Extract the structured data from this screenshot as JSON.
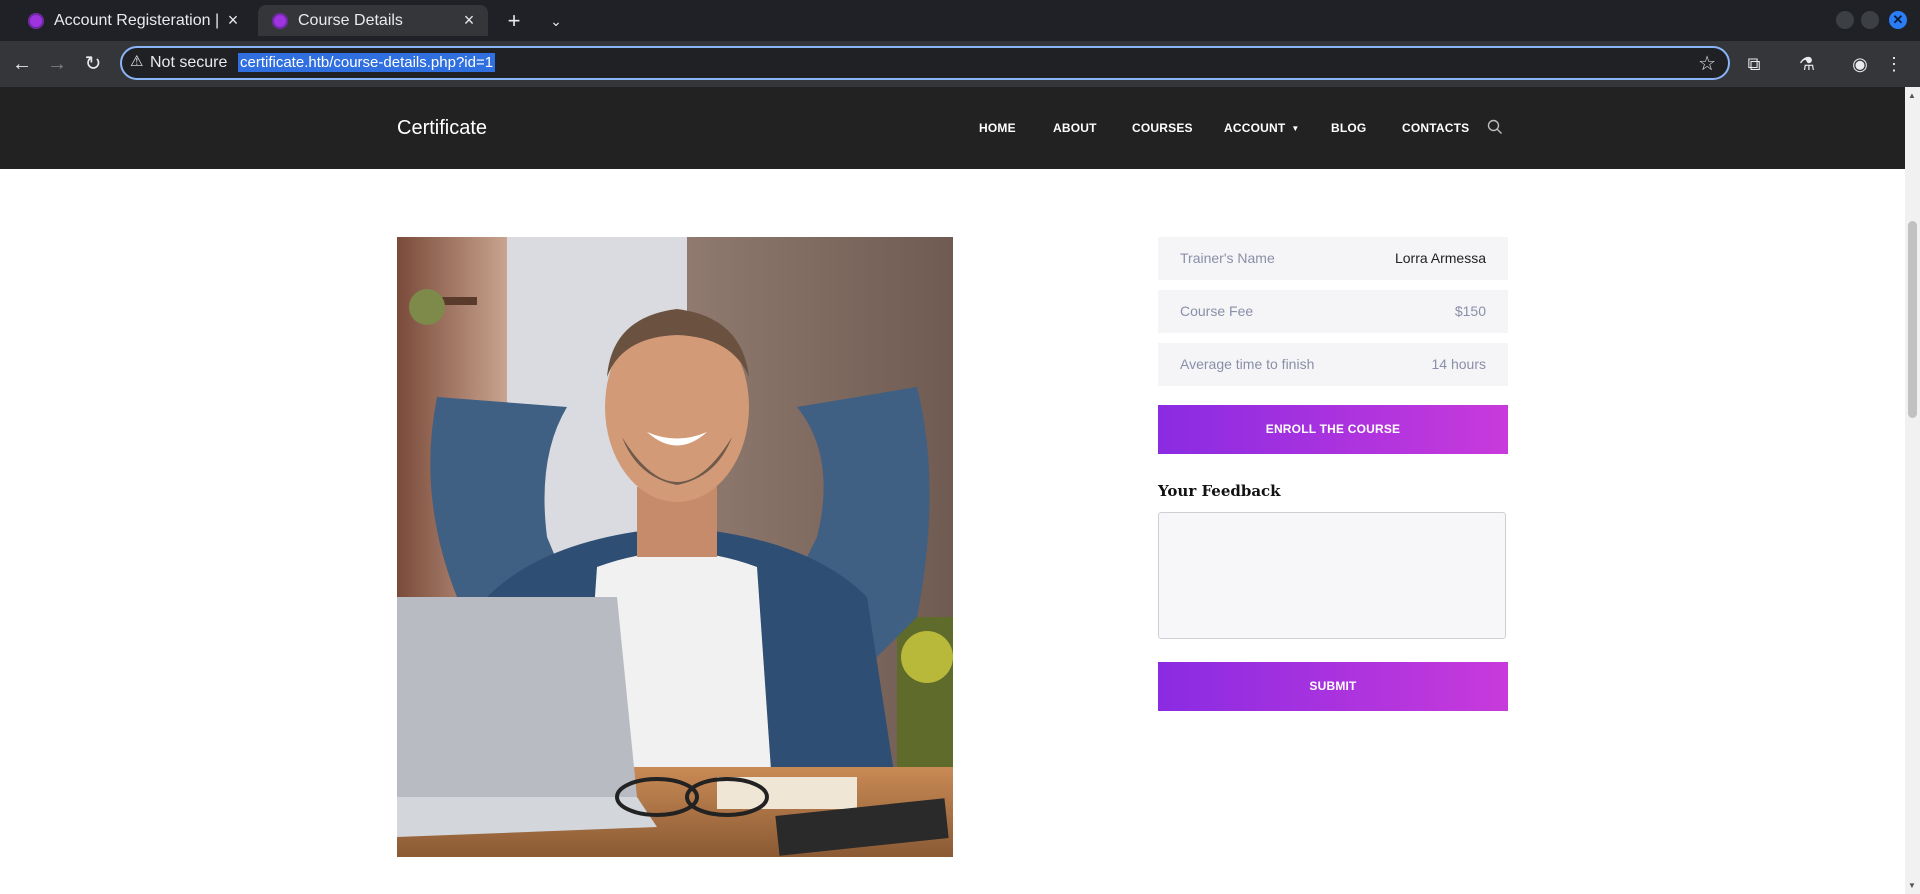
{
  "browser": {
    "tabs": [
      {
        "title": "Account Registeration | C",
        "active": false
      },
      {
        "title": "Course Details",
        "active": true
      }
    ],
    "address": {
      "security_label": "Not secure",
      "url": "certificate.htb/course-details.php?id=1"
    }
  },
  "site": {
    "logo": "Certificate",
    "nav": [
      "HOME",
      "ABOUT",
      "COURSES",
      "ACCOUNT",
      "BLOG",
      "CONTACTS"
    ]
  },
  "course": {
    "info": [
      {
        "label": "Trainer's Name",
        "value": "Lorra Armessa"
      },
      {
        "label": "Course Fee",
        "value": "$150"
      },
      {
        "label": "Average time to finish",
        "value": "14 hours"
      }
    ],
    "enroll_label": "ENROLL THE COURSE",
    "feedback_title": "Your Feedback",
    "submit_label": "SUBMIT"
  },
  "colors": {
    "header_bg": "#222222",
    "button_gradient_start": "#8a2be2",
    "button_gradient_end": "#c83adb"
  }
}
